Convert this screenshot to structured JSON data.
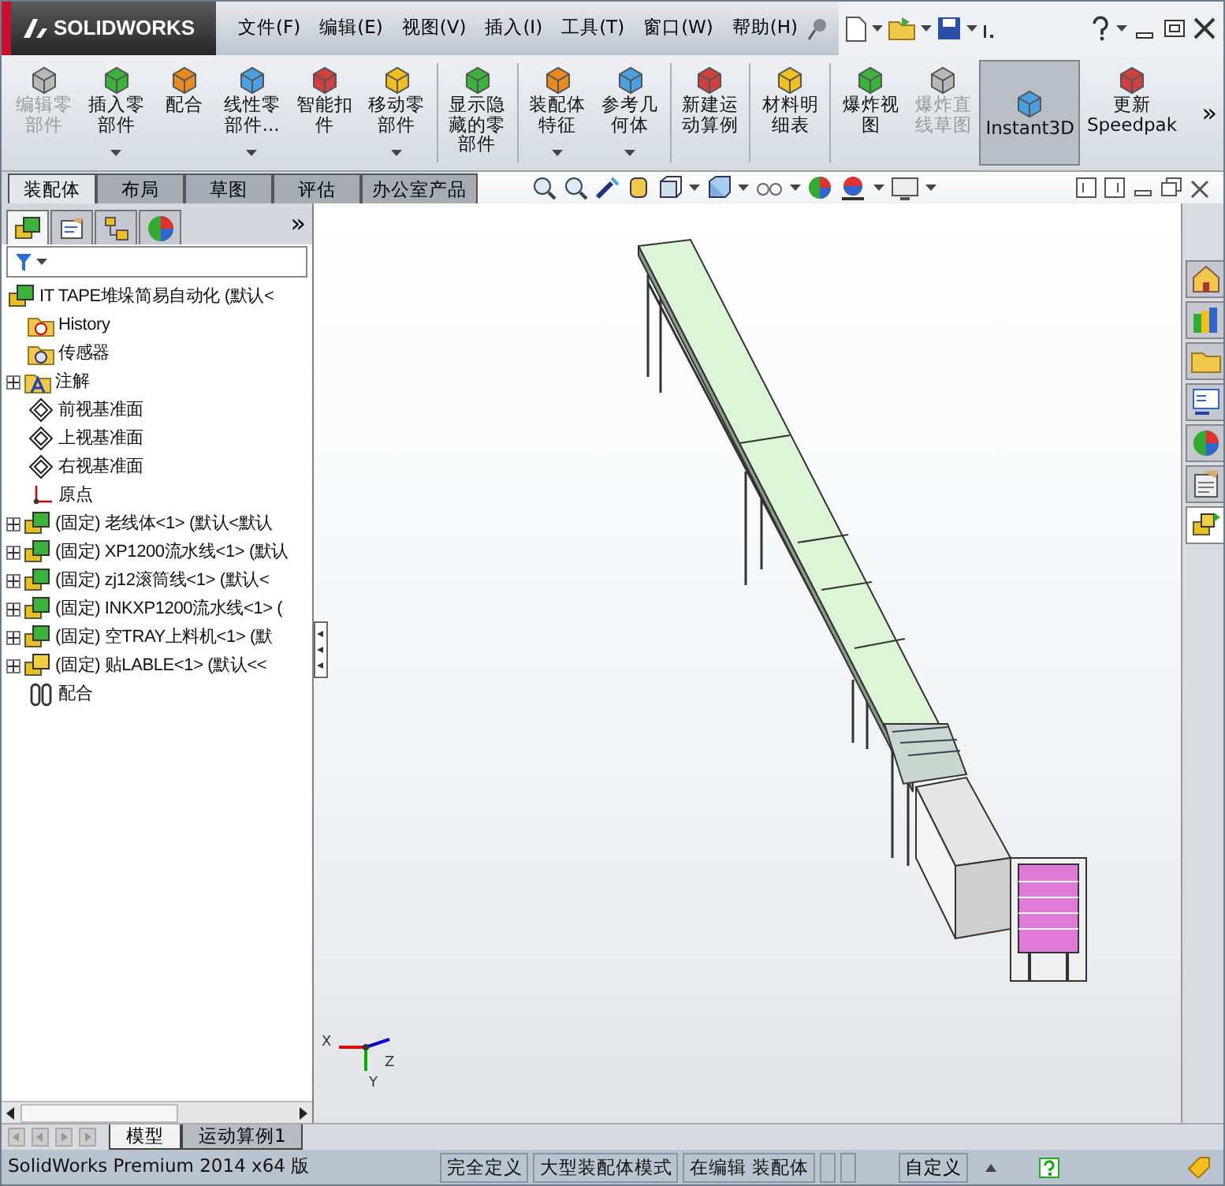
{
  "app": {
    "logo_text": "SOLIDWORKS"
  },
  "menu": [
    {
      "label": "文件(F)"
    },
    {
      "label": "编辑(E)"
    },
    {
      "label": "视图(V)"
    },
    {
      "label": "插入(I)"
    },
    {
      "label": "工具(T)"
    },
    {
      "label": "窗口(W)"
    },
    {
      "label": "帮助(H)"
    }
  ],
  "ribbon": [
    {
      "label": "编辑零部件",
      "disabled": true,
      "dropdown": false,
      "selected": false,
      "separator_before": false
    },
    {
      "label": "插入零部件",
      "disabled": false,
      "dropdown": true,
      "selected": false,
      "separator_before": false
    },
    {
      "label": "配合",
      "disabled": false,
      "dropdown": false,
      "selected": false,
      "separator_before": false
    },
    {
      "label": "线性零部件...",
      "disabled": false,
      "dropdown": true,
      "selected": false,
      "separator_before": false
    },
    {
      "label": "智能扣件",
      "disabled": false,
      "dropdown": false,
      "selected": false,
      "separator_before": false
    },
    {
      "label": "移动零部件",
      "disabled": false,
      "dropdown": true,
      "selected": false,
      "separator_before": false
    },
    {
      "label": "显示隐藏的零部件",
      "disabled": false,
      "dropdown": false,
      "selected": false,
      "separator_before": true
    },
    {
      "label": "装配体特征",
      "disabled": false,
      "dropdown": true,
      "selected": false,
      "separator_before": true
    },
    {
      "label": "参考几何体",
      "disabled": false,
      "dropdown": true,
      "selected": false,
      "separator_before": false
    },
    {
      "label": "新建运动算例",
      "disabled": false,
      "dropdown": false,
      "selected": false,
      "separator_before": true
    },
    {
      "label": "材料明细表",
      "disabled": false,
      "dropdown": false,
      "selected": false,
      "separator_before": true
    },
    {
      "label": "爆炸视图",
      "disabled": false,
      "dropdown": false,
      "selected": false,
      "separator_before": true
    },
    {
      "label": "爆炸直线草图",
      "disabled": true,
      "dropdown": false,
      "selected": false,
      "separator_before": false
    },
    {
      "label": "Instant3D",
      "disabled": false,
      "dropdown": false,
      "selected": true,
      "separator_before": false
    },
    {
      "label": "更新Speedpak",
      "disabled": false,
      "dropdown": false,
      "selected": false,
      "separator_before": false
    }
  ],
  "ribbon_more": "»",
  "command_tabs": [
    {
      "label": "装配体",
      "selected": true
    },
    {
      "label": "布局",
      "selected": false
    },
    {
      "label": "草图",
      "selected": false
    },
    {
      "label": "评估",
      "selected": false
    },
    {
      "label": "办公室产品",
      "selected": false
    }
  ],
  "manager_tabs": [
    {
      "kind": "assembly",
      "selected": true
    },
    {
      "kind": "property",
      "selected": false
    },
    {
      "kind": "config",
      "selected": false
    },
    {
      "kind": "display",
      "selected": false
    }
  ],
  "manager_more": "»",
  "tree": {
    "label": "IT TAPE堆垛简易自动化 (默认<",
    "kind": "assembly",
    "children": [
      {
        "label": "History",
        "kind": "history",
        "expander": false
      },
      {
        "label": "传感器",
        "kind": "sensor",
        "expander": false
      },
      {
        "label": "注解",
        "kind": "annotation",
        "expander": true
      },
      {
        "label": "前视基准面",
        "kind": "plane",
        "expander": false
      },
      {
        "label": "上视基准面",
        "kind": "plane",
        "expander": false
      },
      {
        "label": "右视基准面",
        "kind": "plane",
        "expander": false
      },
      {
        "label": "原点",
        "kind": "origin",
        "expander": false
      },
      {
        "label": "(固定) 老线体<1> (默认<默认",
        "kind": "part",
        "expander": true
      },
      {
        "label": "(固定) XP1200流水线<1> (默认",
        "kind": "part",
        "expander": true
      },
      {
        "label": "(固定) zj12滚筒线<1> (默认<",
        "kind": "part",
        "expander": true
      },
      {
        "label": "(固定) INKXP1200流水线<1> (",
        "kind": "part",
        "expander": true
      },
      {
        "label": "(固定) 空TRAY上料机<1> (默",
        "kind": "part",
        "expander": true
      },
      {
        "label": "(固定) 贴LABLE<1> (默认<<",
        "kind": "subassembly",
        "expander": true
      },
      {
        "label": "配合",
        "kind": "mates",
        "expander": false
      }
    ]
  },
  "task_pane": [
    {
      "kind": "home",
      "selected": false
    },
    {
      "kind": "library",
      "selected": false
    },
    {
      "kind": "folder",
      "selected": false
    },
    {
      "kind": "properties",
      "selected": false
    },
    {
      "kind": "appearance",
      "selected": false
    },
    {
      "kind": "clipboard",
      "selected": false
    },
    {
      "kind": "assembly",
      "selected": true
    }
  ],
  "triad": [
    "X",
    "Y",
    "Z"
  ],
  "bottom_tabs": [
    {
      "label": "模型",
      "selected": true
    },
    {
      "label": "运动算例1",
      "selected": false
    }
  ],
  "status_bar": {
    "product": "SolidWorks Premium 2014 x64 版",
    "fields": [
      "完全定义",
      "大型装配体模式",
      "在编辑 装配体"
    ],
    "units": "自定义"
  }
}
